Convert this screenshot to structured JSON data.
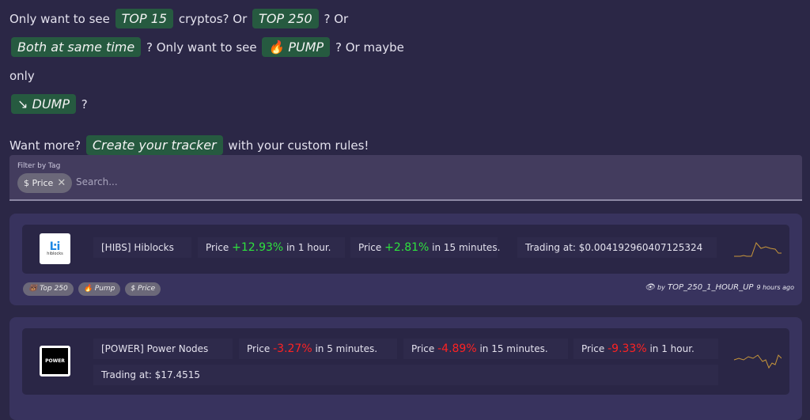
{
  "intro": {
    "l1a": "Only want to see",
    "top15": "TOP 15",
    "l1b": "cryptos? Or",
    "top250": "TOP 250",
    "l1c": "? Or",
    "both": "Both at same time",
    "l2a": "? Only want to see",
    "pump": "🔥 PUMP",
    "l2b": "? Or maybe only",
    "dump": "↘ DUMP",
    "l3": "?",
    "want": "Want more?",
    "create": "Create your tracker",
    "custom": "with your custom rules!"
  },
  "filter": {
    "label": "Filter by Tag",
    "chip": "$ Price",
    "remove": "✕",
    "placeholder": "Search..."
  },
  "cards": [
    {
      "name": "[HIBS] Hiblocks",
      "logo_text": "hiblocks",
      "c1": {
        "pre": "Price",
        "val": "+12.93%",
        "post": "in 1 hour."
      },
      "c2": {
        "pre": "Price",
        "val": "+2.81%",
        "post": "in 15 minutes."
      },
      "trading": "Trading at: $0.004192960407125324",
      "tags": [
        "🐻 Top 250",
        "🔥 Pump",
        "$ Price"
      ],
      "by": "by",
      "rule": "TOP_250_1_HOUR_UP",
      "ago": "9 hours ago"
    },
    {
      "name": "[POWER] Power Nodes",
      "logo_text": "POWER",
      "c1": {
        "pre": "Price",
        "val": "-3.27%",
        "post": "in 5 minutes."
      },
      "c2": {
        "pre": "Price",
        "val": "-4.89%",
        "post": "in 15 minutes."
      },
      "c3": {
        "pre": "Price",
        "val": "-9.33%",
        "post": "in 1 hour."
      },
      "trading": "Trading at: $17.4515"
    }
  ],
  "colors": {
    "bg": "#2b2746",
    "green": "#265a40",
    "up": "#2ee23e",
    "down": "#ff2222",
    "spark": "#c9973a"
  }
}
